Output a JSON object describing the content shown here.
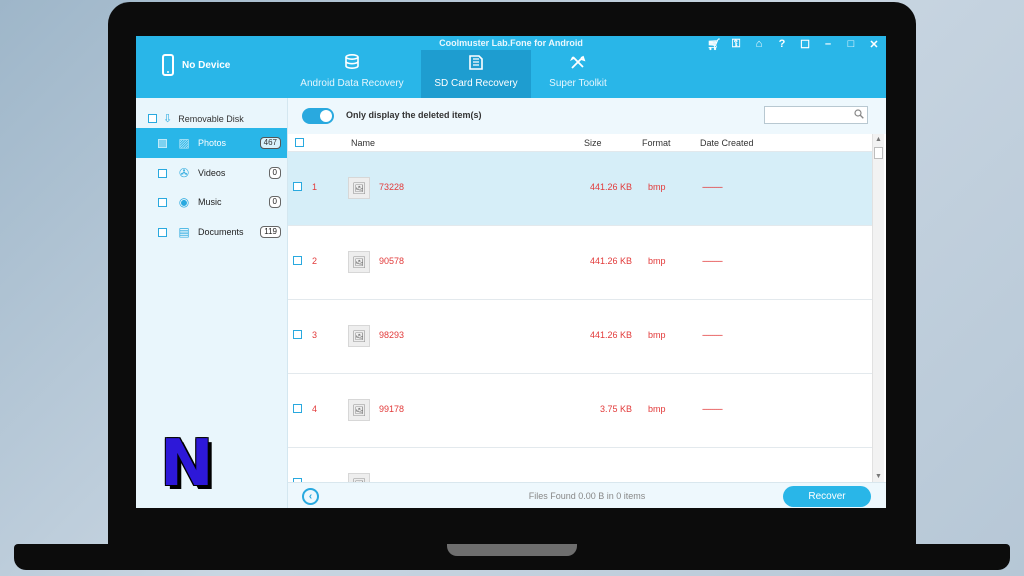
{
  "app": {
    "title": "Coolmuster Lab.Fone for Android"
  },
  "device": {
    "label": "No Device"
  },
  "tabs": [
    {
      "label": "Android Data Recovery",
      "icon": "database-restore-icon"
    },
    {
      "label": "SD Card Recovery",
      "icon": "sd-card-icon",
      "active": true
    },
    {
      "label": "Super Toolkit",
      "icon": "tools-icon"
    }
  ],
  "window_controls": [
    "cart-icon",
    "key-icon",
    "home-icon",
    "help-icon",
    "feedback-icon",
    "minimize-icon",
    "maximize-icon",
    "close-icon"
  ],
  "sidebar": {
    "root": {
      "label": "Removable Disk",
      "icon": "usb-icon"
    },
    "items": [
      {
        "label": "Photos",
        "count": "467",
        "icon": "photo-icon",
        "active": true
      },
      {
        "label": "Videos",
        "count": "0",
        "icon": "film-reel-icon"
      },
      {
        "label": "Music",
        "count": "0",
        "icon": "music-disc-icon"
      },
      {
        "label": "Documents",
        "count": "119",
        "icon": "document-icon"
      }
    ]
  },
  "toolbar": {
    "toggle_label": "Only display the deleted item(s)",
    "toggle_on": true,
    "search_placeholder": ""
  },
  "table": {
    "columns": {
      "name": "Name",
      "size": "Size",
      "format": "Format",
      "date": "Date Created"
    },
    "rows": [
      {
        "index": "1",
        "name": "73228",
        "size": "441.26 KB",
        "format": "bmp",
        "date": "----------",
        "selected": true
      },
      {
        "index": "2",
        "name": "90578",
        "size": "441.26 KB",
        "format": "bmp",
        "date": "----------"
      },
      {
        "index": "3",
        "name": "98293",
        "size": "441.26 KB",
        "format": "bmp",
        "date": "----------"
      },
      {
        "index": "4",
        "name": "99178",
        "size": "3.75 KB",
        "format": "bmp",
        "date": "----------"
      }
    ]
  },
  "footer": {
    "files_found": "Files Found 0.00 B in 0 items",
    "recover_label": "Recover"
  },
  "brand": {
    "logo_letter": "N"
  },
  "colors": {
    "accent": "#29b6e8",
    "active_tab": "#1e9dd0",
    "deleted_text": "#e23a3a",
    "brand_logo": "#2d18d8"
  }
}
